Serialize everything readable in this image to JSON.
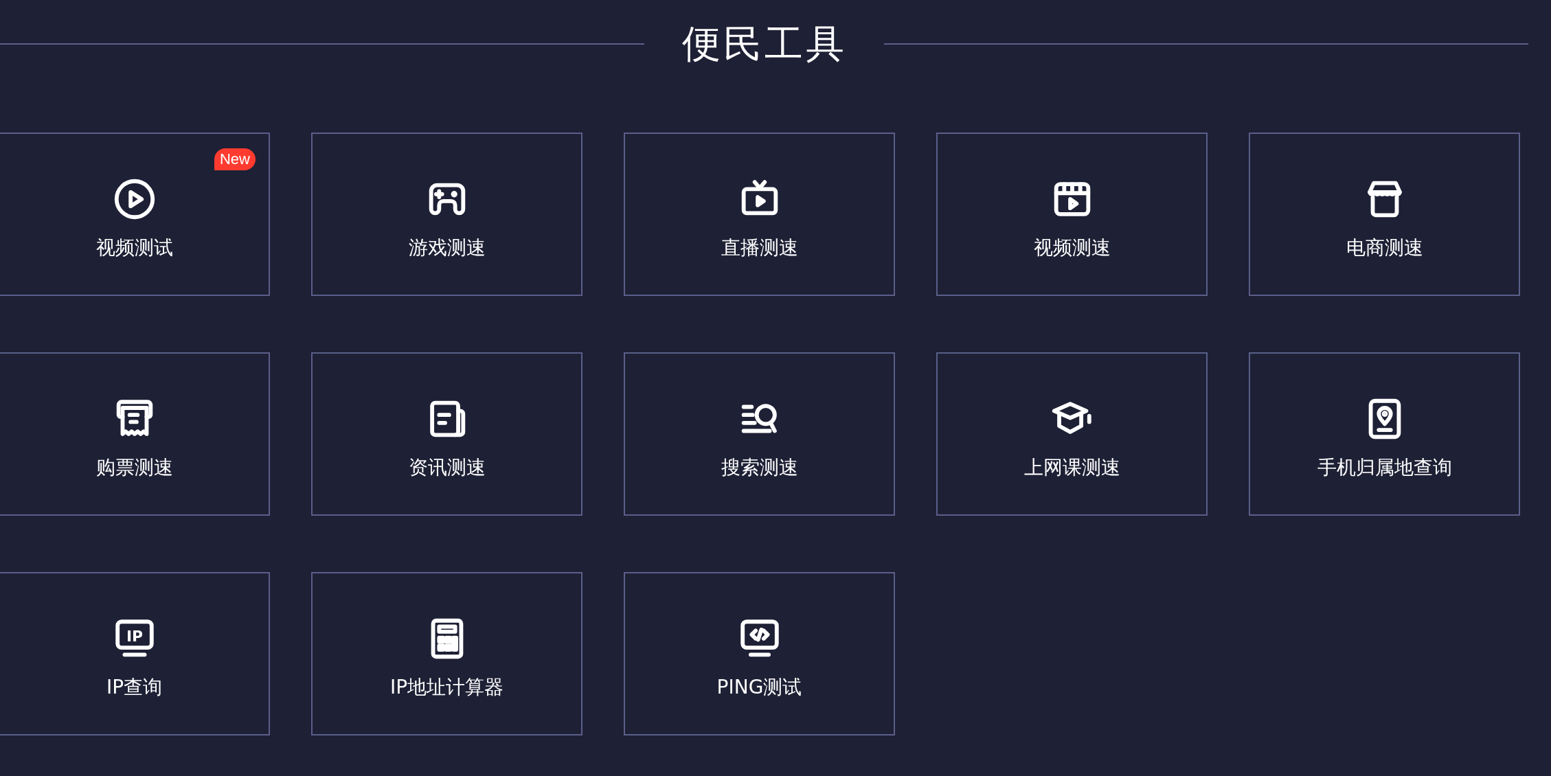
{
  "title": "便民工具",
  "tools": [
    {
      "kind": "play",
      "label": "视频测试",
      "badge": "New"
    },
    {
      "kind": "gamepad",
      "label": "游戏测速"
    },
    {
      "kind": "tv",
      "label": "直播测速"
    },
    {
      "kind": "clapper",
      "label": "视频测速"
    },
    {
      "kind": "store",
      "label": "电商测速"
    },
    {
      "kind": "receipt",
      "label": "购票测速"
    },
    {
      "kind": "news",
      "label": "资讯测速"
    },
    {
      "kind": "search",
      "label": "搜索测速"
    },
    {
      "kind": "cap",
      "label": "上网课测速"
    },
    {
      "kind": "phone-pin",
      "label": "手机归属地查询"
    },
    {
      "kind": "ip",
      "label": "IP查询",
      "icon_text": "IP"
    },
    {
      "kind": "calculator",
      "label": "IP地址计算器"
    },
    {
      "kind": "code",
      "label": "PING测试"
    }
  ]
}
